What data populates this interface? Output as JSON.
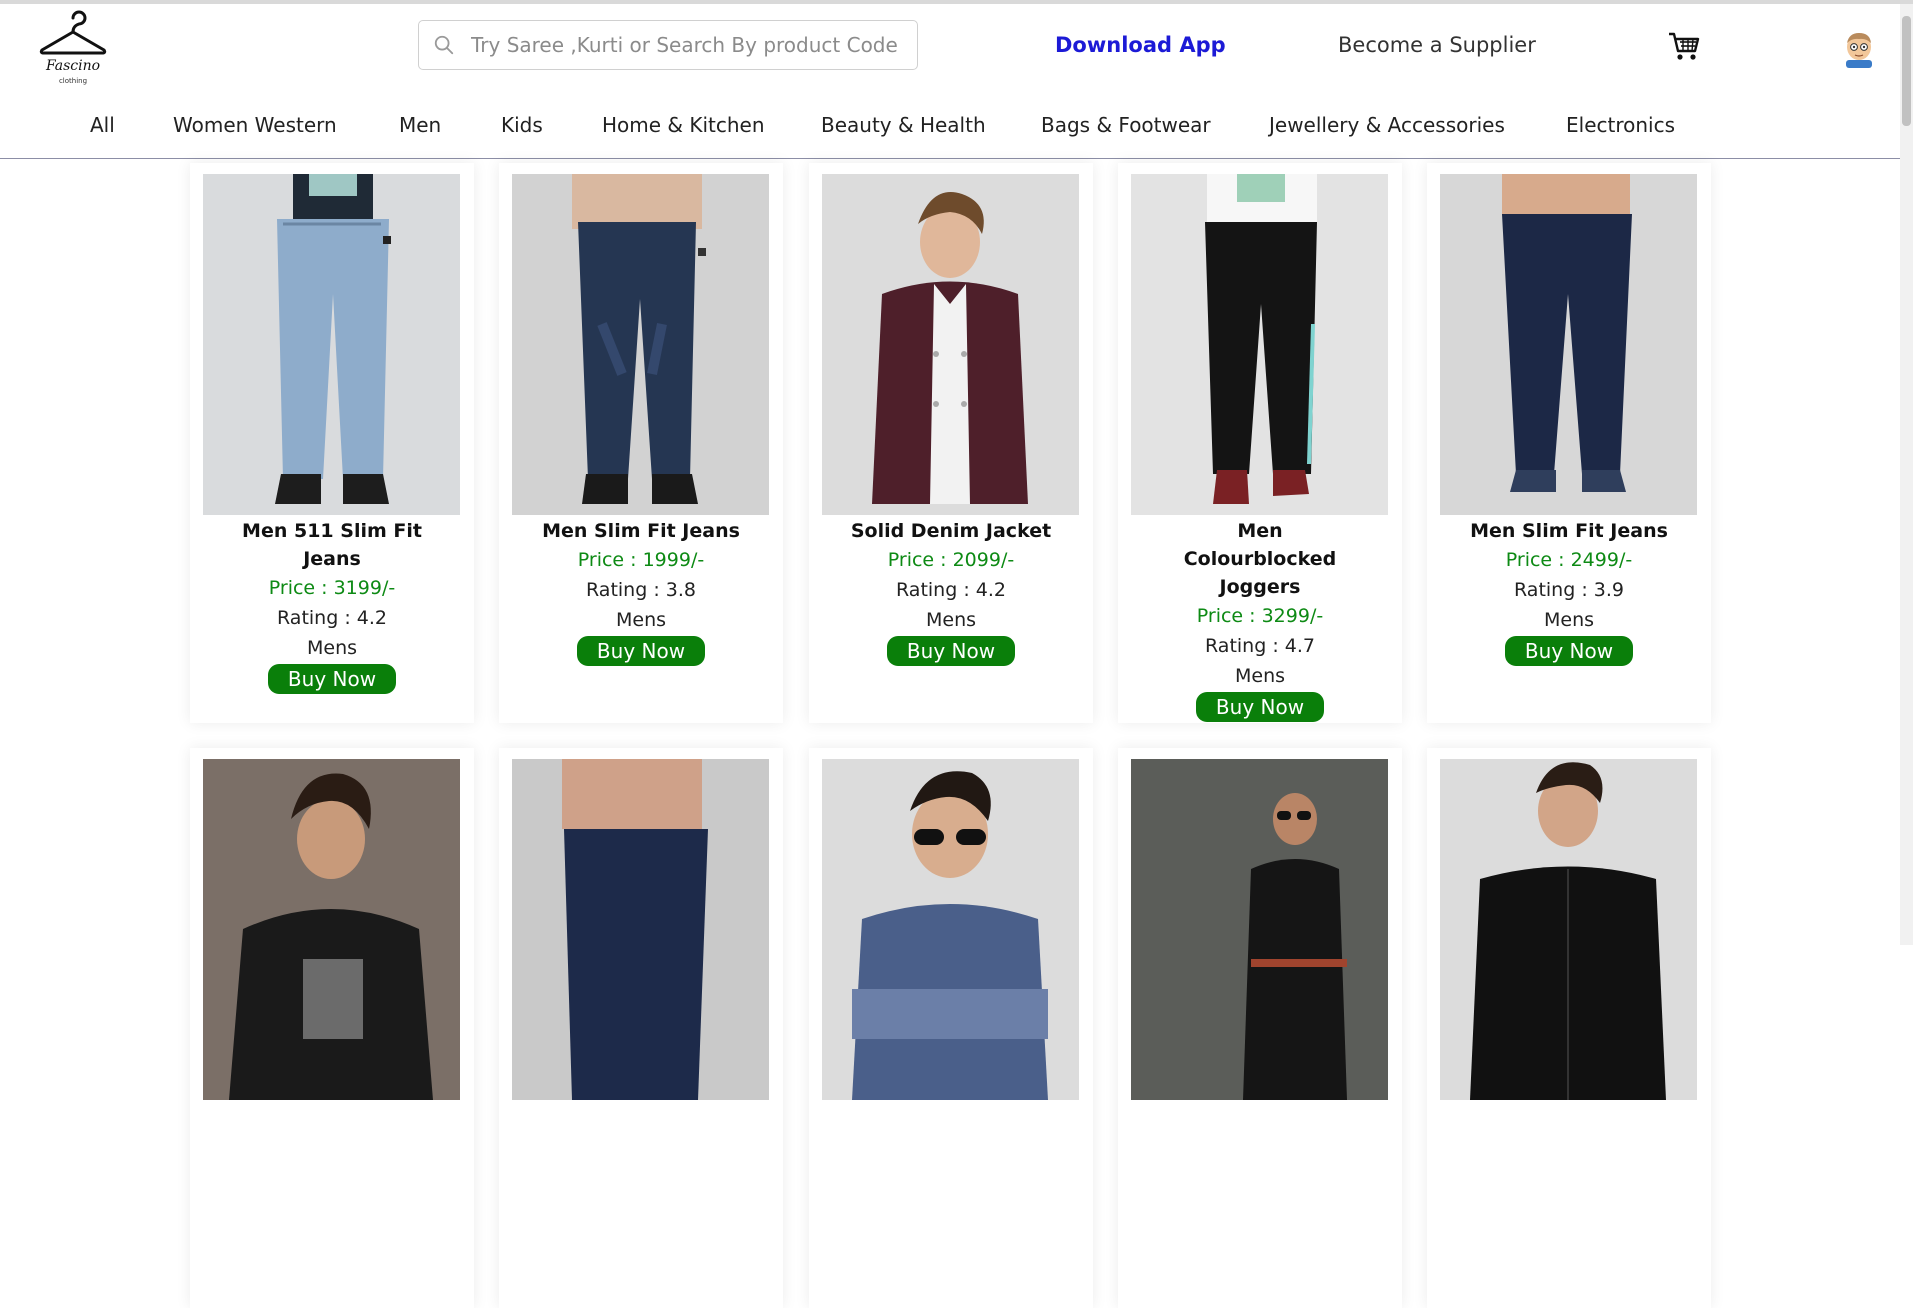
{
  "brand": {
    "name": "Fascino",
    "tagline": "clothing"
  },
  "search": {
    "placeholder": "Try Saree ,Kurti or Search By product Code"
  },
  "header": {
    "download_label": "Download App",
    "supplier_label": "Become a Supplier"
  },
  "nav": {
    "items": [
      {
        "label": "All"
      },
      {
        "label": "Women Western"
      },
      {
        "label": "Men"
      },
      {
        "label": "Kids"
      },
      {
        "label": "Home & Kitchen"
      },
      {
        "label": "Beauty & Health"
      },
      {
        "label": "Bags & Footwear"
      },
      {
        "label": "Jewellery & Accessories"
      },
      {
        "label": "Electronics"
      }
    ]
  },
  "products": [
    {
      "title": "Men 511 Slim Fit Jeans",
      "price": "Price : 3199/-",
      "rating": "Rating : 4.2",
      "category": "Mens",
      "buy_label": "Buy Now"
    },
    {
      "title": "Men Slim Fit Jeans",
      "price": "Price : 1999/-",
      "rating": "Rating : 3.8",
      "category": "Mens",
      "buy_label": "Buy Now"
    },
    {
      "title": "Solid Denim Jacket",
      "price": "Price : 2099/-",
      "rating": "Rating : 4.2",
      "category": "Mens",
      "buy_label": "Buy Now"
    },
    {
      "title": "Men Colourblocked Joggers",
      "price": "Price : 3299/-",
      "rating": "Rating : 4.7",
      "category": "Mens",
      "buy_label": "Buy Now"
    },
    {
      "title": "Men Slim Fit Jeans",
      "price": "Price : 2499/-",
      "rating": "Rating : 3.9",
      "category": "Mens",
      "buy_label": "Buy Now"
    }
  ],
  "colors": {
    "price": "#0d8a14",
    "buy_button": "#0a7f0a",
    "download_link": "#1c1ad6"
  }
}
